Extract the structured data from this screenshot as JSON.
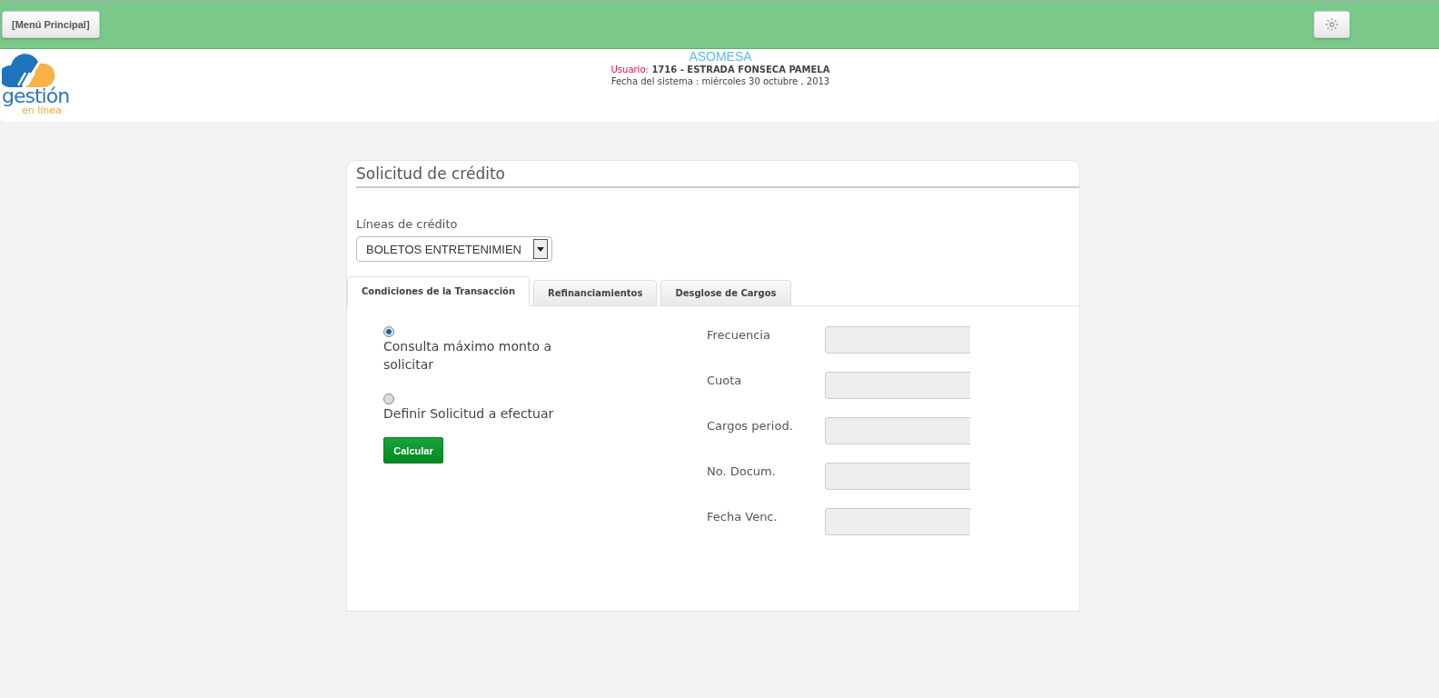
{
  "top_bar": {
    "menu_button": "[Menú Principal]"
  },
  "header": {
    "logo_main": "gestión",
    "logo_sub": "en línea",
    "company": "ASOMESA",
    "user_label": "Usuario:",
    "user_value": "1716 - ESTRADA FONSECA PAMELA",
    "system_date": "Fecha del sistema : miércoles 30 octubre , 2013"
  },
  "form": {
    "title": "Solicitud de crédito",
    "credit_lines_label": "Líneas de crédito",
    "credit_line_value": "BOLETOS ENTRETENIMIEN",
    "tabs": [
      {
        "label": "Condiciones de la Transacción",
        "selected": true
      },
      {
        "label": "Refinanciamientos",
        "selected": false
      },
      {
        "label": "Desglose de Cargos",
        "selected": false
      }
    ],
    "options": [
      {
        "label": "Consulta máximo monto a solicitar",
        "selected": true
      },
      {
        "label": "Definir Solicitud a efectuar",
        "selected": false
      }
    ],
    "calculate_button": "Calcular",
    "fields": [
      {
        "label": "Frecuencia"
      },
      {
        "label": "Cuota"
      },
      {
        "label": "Cargos period."
      },
      {
        "label": "No. Docum."
      },
      {
        "label": "Fecha Venc."
      }
    ]
  }
}
